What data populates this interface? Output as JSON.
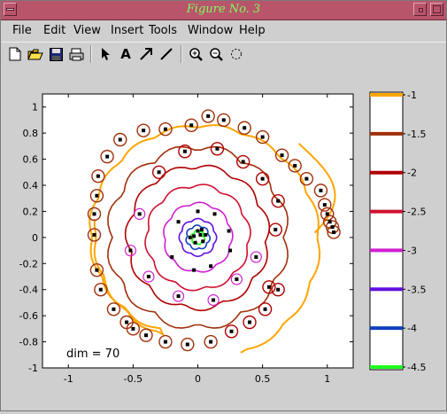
{
  "window": {
    "title": "Figure No. 3"
  },
  "menu": {
    "items": [
      "File",
      "Edit",
      "View",
      "Insert",
      "Tools",
      "Window",
      "Help"
    ]
  },
  "toolbar": {
    "items": [
      "new-icon",
      "open-icon",
      "save-icon",
      "print-icon",
      "arrow-icon",
      "text-icon",
      "line-arrow-icon",
      "line-icon",
      "zoom-in-icon",
      "zoom-out-icon",
      "rotate-icon"
    ]
  },
  "chart_data": {
    "type": "contour",
    "annotation": "dim = 70",
    "xlim": [
      -1.2,
      1.2
    ],
    "ylim": [
      -1,
      1.1
    ],
    "xticks": [
      "-1",
      "-0.5",
      "0",
      "0.5",
      "1"
    ],
    "xtick_values": [
      -1,
      -0.5,
      0,
      0.5,
      1
    ],
    "yticks": [
      "1",
      "0.8",
      "0.6",
      "0.4",
      "0.2",
      "0",
      "-0.2",
      "-0.4",
      "-0.6",
      "-0.8",
      "-1"
    ],
    "ytick_values": [
      1,
      0.8,
      0.6,
      0.4,
      0.2,
      0,
      -0.2,
      -0.4,
      -0.6,
      -0.8,
      -1
    ],
    "colorbar": {
      "labels": [
        "-1",
        "-1.5",
        "-2",
        "-2.5",
        "-3",
        "-3.5",
        "-4",
        "-4.5"
      ],
      "values": [
        -1,
        -1.5,
        -2,
        -2.5,
        -3,
        -3.5,
        -4,
        -4.5
      ],
      "colors": [
        "#ffa500",
        "#a0300a",
        "#b00000",
        "#d01030",
        "#d020d0",
        "#6010e0",
        "#1040c0",
        "#20ff20"
      ]
    },
    "contour_levels": [
      {
        "level": -1,
        "color": "#ffa500",
        "shape": "outer-spiral"
      },
      {
        "level": -1.5,
        "color": "#a0300a",
        "radius": 0.66
      },
      {
        "level": -2,
        "color": "#b00000",
        "radius": 0.52
      },
      {
        "level": -2.5,
        "color": "#d01030",
        "radius": 0.38
      },
      {
        "level": -3,
        "color": "#d020d0",
        "radius": 0.25
      },
      {
        "level": -3.5,
        "color": "#6010e0",
        "radius": 0.13
      },
      {
        "level": -4,
        "color": "#1040c0",
        "radius": 0.08
      },
      {
        "level": -4.5,
        "color": "#20ff20",
        "radius": 0.04
      }
    ],
    "points": [
      [
        0.08,
        0.93
      ],
      [
        0.2,
        0.9
      ],
      [
        -0.05,
        0.86
      ],
      [
        0.36,
        0.84
      ],
      [
        -0.42,
        0.82
      ],
      [
        -0.25,
        0.83
      ],
      [
        0.5,
        0.77
      ],
      [
        -0.6,
        0.75
      ],
      [
        0.65,
        0.63
      ],
      [
        -0.7,
        0.62
      ],
      [
        0.75,
        0.55
      ],
      [
        0.84,
        0.45
      ],
      [
        -0.77,
        0.47
      ],
      [
        0.95,
        0.36
      ],
      [
        -0.78,
        0.32
      ],
      [
        0.98,
        0.25
      ],
      [
        1.0,
        0.18
      ],
      [
        -0.8,
        0.18
      ],
      [
        1.02,
        0.12
      ],
      [
        1.04,
        0.08
      ],
      [
        1.05,
        0.04
      ],
      [
        -0.8,
        0.02
      ],
      [
        0.15,
        0.68
      ],
      [
        -0.1,
        0.66
      ],
      [
        0.35,
        0.58
      ],
      [
        -0.3,
        0.5
      ],
      [
        0.5,
        0.45
      ],
      [
        0.62,
        0.28
      ],
      [
        -0.45,
        0.18
      ],
      [
        0.6,
        0.06
      ],
      [
        -0.52,
        -0.1
      ],
      [
        0.45,
        -0.15
      ],
      [
        -0.38,
        -0.3
      ],
      [
        0.3,
        -0.32
      ],
      [
        -0.15,
        -0.45
      ],
      [
        0.12,
        -0.48
      ],
      [
        0.0,
        0.2
      ],
      [
        0.13,
        0.18
      ],
      [
        -0.15,
        0.12
      ],
      [
        0.24,
        0.05
      ],
      [
        0.25,
        -0.1
      ],
      [
        -0.2,
        -0.15
      ],
      [
        0.1,
        -0.22
      ],
      [
        -0.03,
        -0.25
      ],
      [
        0.02,
        0.02
      ],
      [
        -0.03,
        0.01
      ],
      [
        0.04,
        -0.03
      ],
      [
        -0.02,
        -0.04
      ],
      [
        0.0,
        0.05
      ],
      [
        0.06,
        0.02
      ],
      [
        -0.06,
        0.0
      ],
      [
        0.03,
        0.06
      ],
      [
        -0.78,
        -0.25
      ],
      [
        -0.75,
        -0.4
      ],
      [
        -0.65,
        -0.55
      ],
      [
        -0.55,
        -0.65
      ],
      [
        -0.5,
        -0.7
      ],
      [
        -0.4,
        -0.75
      ],
      [
        -0.25,
        -0.8
      ],
      [
        -0.08,
        -0.82
      ],
      [
        0.1,
        -0.8
      ],
      [
        0.26,
        -0.72
      ],
      [
        0.4,
        -0.65
      ],
      [
        0.52,
        -0.55
      ],
      [
        0.55,
        -0.38
      ],
      [
        0.62,
        -0.4
      ]
    ]
  }
}
